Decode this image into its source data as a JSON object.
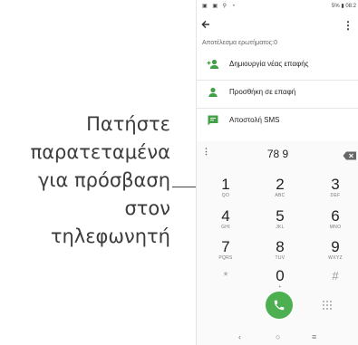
{
  "callout": {
    "lines": [
      "Πατήστε",
      "παρατεταμένα",
      "για πρόσβαση",
      "στον",
      "τηλεφωνητή"
    ]
  },
  "status_bar": {
    "left_icons": "▣ ▣ ⚲ ◔",
    "battery": "5%",
    "time": "08:2"
  },
  "header": {
    "back_icon": "arrow-left-icon",
    "menu_icon": "more-vert-icon",
    "menu_glyph": "⋮"
  },
  "search_result": "Αποτέλεσμα ερωτήματος:0",
  "actions": [
    {
      "label": "Δημιουργία νέας επαφής",
      "icon": "person-add-icon"
    },
    {
      "label": "Προσθήκη σε επαφή",
      "icon": "person-icon"
    },
    {
      "label": "Αποστολή SMS",
      "icon": "message-icon"
    }
  ],
  "dialer": {
    "number": "78 9",
    "more_glyph": "⋮",
    "keys": [
      {
        "digit": "1",
        "letters": "QO"
      },
      {
        "digit": "2",
        "letters": "ABC"
      },
      {
        "digit": "3",
        "letters": "DEF"
      },
      {
        "digit": "4",
        "letters": "GHI"
      },
      {
        "digit": "5",
        "letters": "JKL"
      },
      {
        "digit": "6",
        "letters": "MNO"
      },
      {
        "digit": "7",
        "letters": "PQRS"
      },
      {
        "digit": "8",
        "letters": "TUV"
      },
      {
        "digit": "9",
        "letters": "WXYZ"
      },
      {
        "digit": "*",
        "letters": ""
      },
      {
        "digit": "0",
        "letters": "+"
      },
      {
        "digit": "#",
        "letters": ""
      }
    ]
  },
  "nav": {
    "back": "‹",
    "home": "○",
    "recents": "≡"
  },
  "colors": {
    "accent": "#4caf50",
    "icon_green": "#43a047"
  }
}
